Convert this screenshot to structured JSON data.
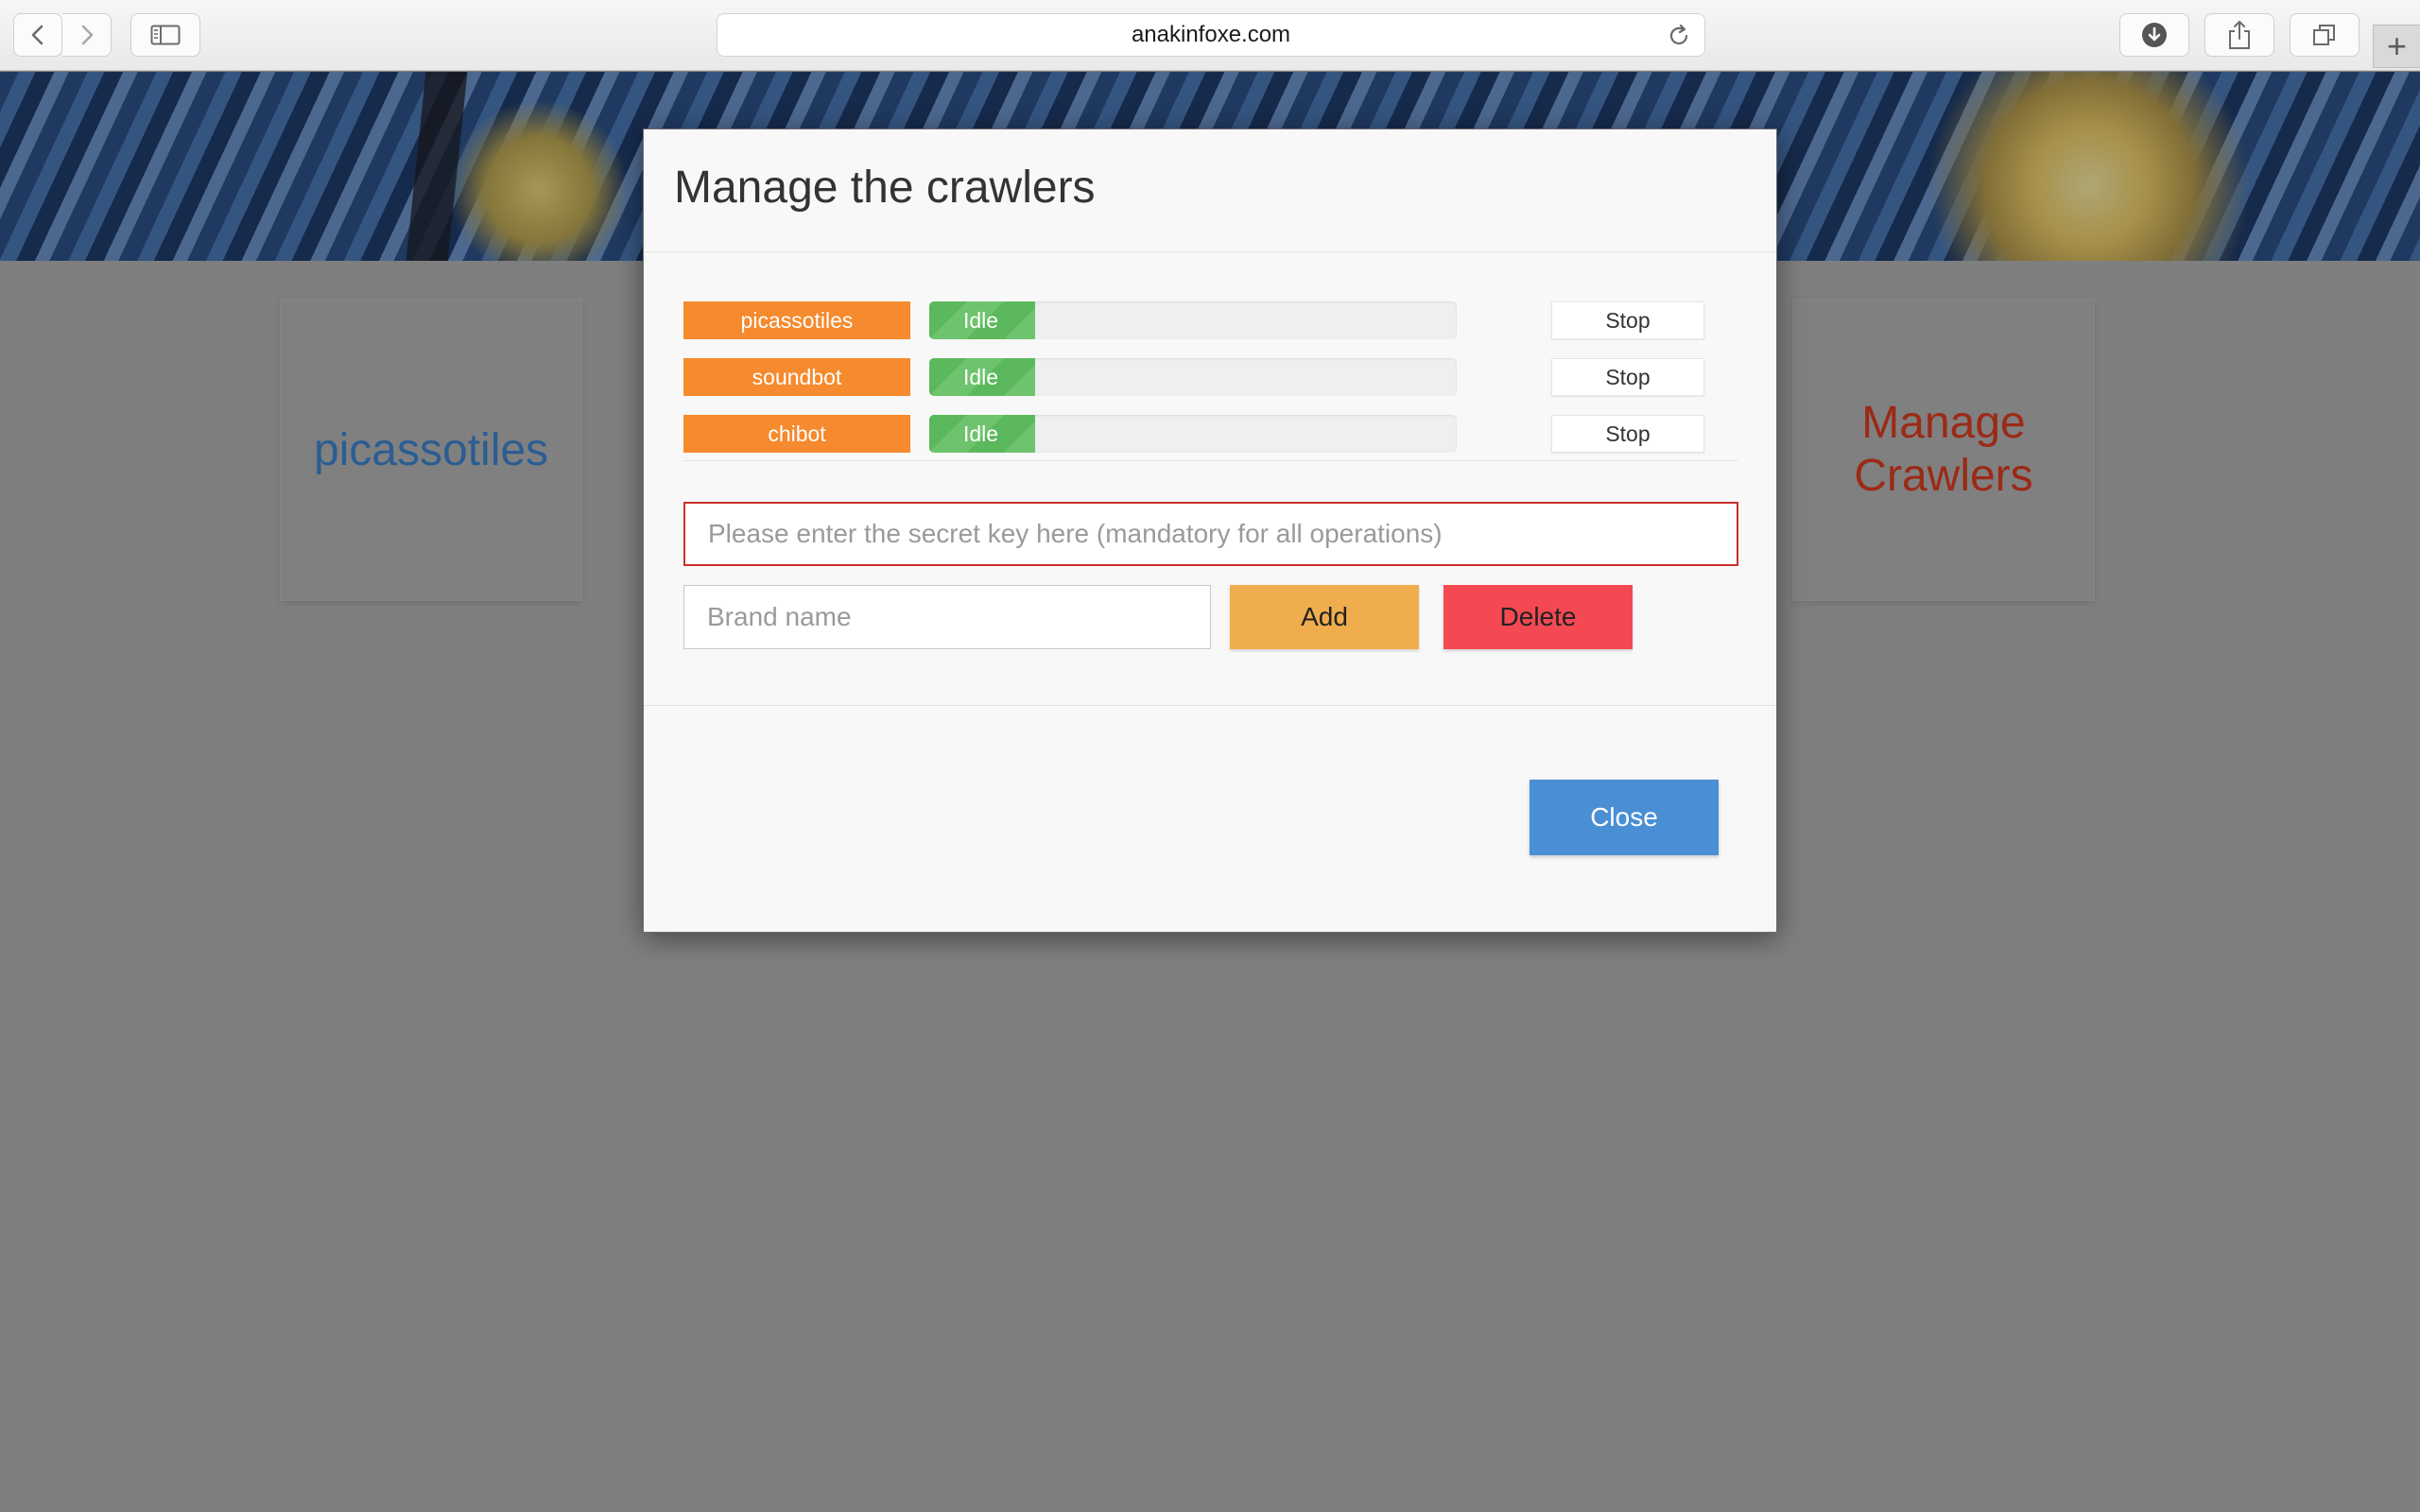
{
  "browser": {
    "url": "anakinfoxe.com",
    "buttons": {
      "back": "chevron-left-icon",
      "forward": "chevron-right-icon",
      "sidebar": "sidebar-icon",
      "downloads": "download-icon",
      "share": "share-icon",
      "tabs": "tabs-icon",
      "new_tab": "+"
    }
  },
  "page": {
    "cards": [
      {
        "label": "picassotiles",
        "color": "#2b5d93"
      },
      {
        "label": "Manage Crawlers",
        "color": "#9b2a16"
      }
    ]
  },
  "modal": {
    "title": "Manage the crawlers",
    "crawlers": [
      {
        "name": "picassotiles",
        "status": "Idle",
        "progress_percent": 20,
        "action": "Stop"
      },
      {
        "name": "soundbot",
        "status": "Idle",
        "progress_percent": 20,
        "action": "Stop"
      },
      {
        "name": "chibot",
        "status": "Idle",
        "progress_percent": 20,
        "action": "Stop"
      }
    ],
    "secret_key": {
      "value": "",
      "placeholder": "Please enter the secret key here (mandatory for all operations)"
    },
    "brand_name": {
      "value": "",
      "placeholder": "Brand name"
    },
    "add_label": "Add",
    "delete_label": "Delete",
    "close_label": "Close"
  },
  "colors": {
    "crawler_tag": "#f58a2e",
    "progress_success": "#5cb85c",
    "add": "#f0ad4e",
    "delete": "#f44953",
    "close": "#4a8fd4",
    "secret_border": "#c9302c"
  }
}
